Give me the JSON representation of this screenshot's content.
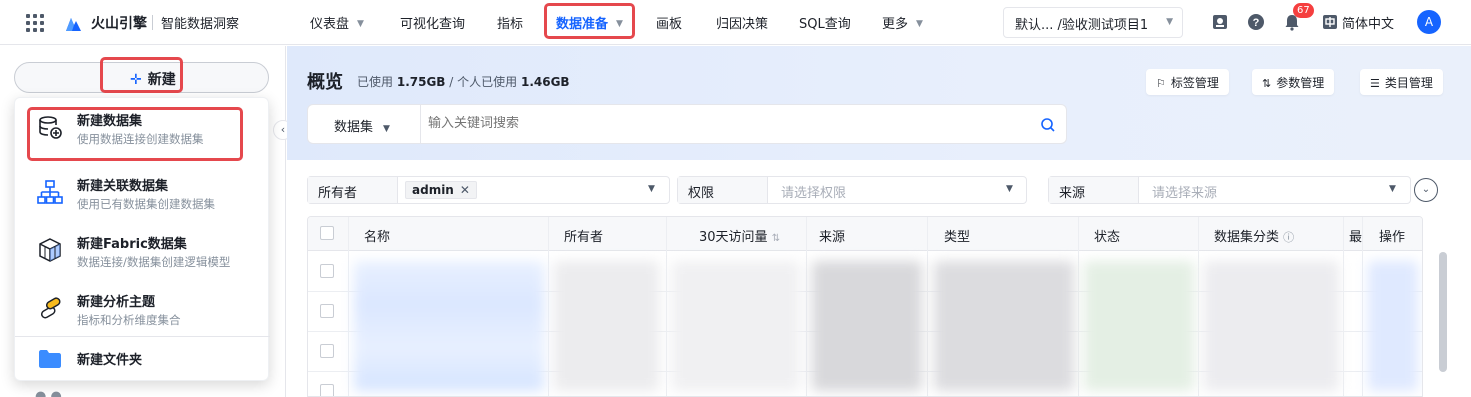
{
  "topbar": {
    "brand": "火山引擎",
    "product": "智能数据洞察",
    "nav": [
      {
        "label": "仪表盘",
        "dropdown": true
      },
      {
        "label": "可视化查询",
        "dropdown": false
      },
      {
        "label": "指标",
        "dropdown": false
      },
      {
        "label": "数据准备",
        "dropdown": true,
        "active": true
      },
      {
        "label": "画板",
        "dropdown": false
      },
      {
        "label": "归因决策",
        "dropdown": false
      },
      {
        "label": "SQL查询",
        "dropdown": false
      },
      {
        "label": "更多",
        "dropdown": true
      }
    ],
    "project": "默认... /验收测试项目1",
    "notification_count": "67",
    "language": "简体中文",
    "avatar_letter": "A",
    "accent_color": "#1664ff"
  },
  "sidebar": {
    "new_button": "新建",
    "collapse_icon": "chevron-left-icon",
    "menu": [
      {
        "title": "新建数据集",
        "desc": "使用数据连接创建数据集",
        "icon": "database-add-icon"
      },
      {
        "title": "新建关联数据集",
        "desc": "使用已有数据集创建数据集",
        "icon": "hierarchy-icon"
      },
      {
        "title": "新建Fabric数据集",
        "desc": "数据连接/数据集创建逻辑模型",
        "icon": "cube-icon"
      },
      {
        "title": "新建分析主题",
        "desc": "指标和分析维度集合",
        "icon": "theme-icon"
      },
      {
        "title": "新建文件夹",
        "desc": "",
        "icon": "folder-icon"
      }
    ]
  },
  "main": {
    "title": "概览",
    "usage_prefix": "已使用",
    "usage_total": "1.75GB",
    "usage_mid": "/ 个人已使用",
    "usage_personal": "1.46GB",
    "header_buttons": [
      "标签管理",
      "参数管理",
      "类目管理"
    ],
    "search": {
      "type": "数据集",
      "placeholder": "输入关键词搜索"
    },
    "filters": {
      "owner_label": "所有者",
      "owner_tag": "admin",
      "permission_label": "权限",
      "permission_placeholder": "请选择权限",
      "source_label": "来源",
      "source_placeholder": "请选择来源"
    },
    "table": {
      "columns": [
        "名称",
        "所有者",
        "30天访问量",
        "来源",
        "类型",
        "状态",
        "数据集分类",
        "最",
        "操作"
      ]
    }
  }
}
